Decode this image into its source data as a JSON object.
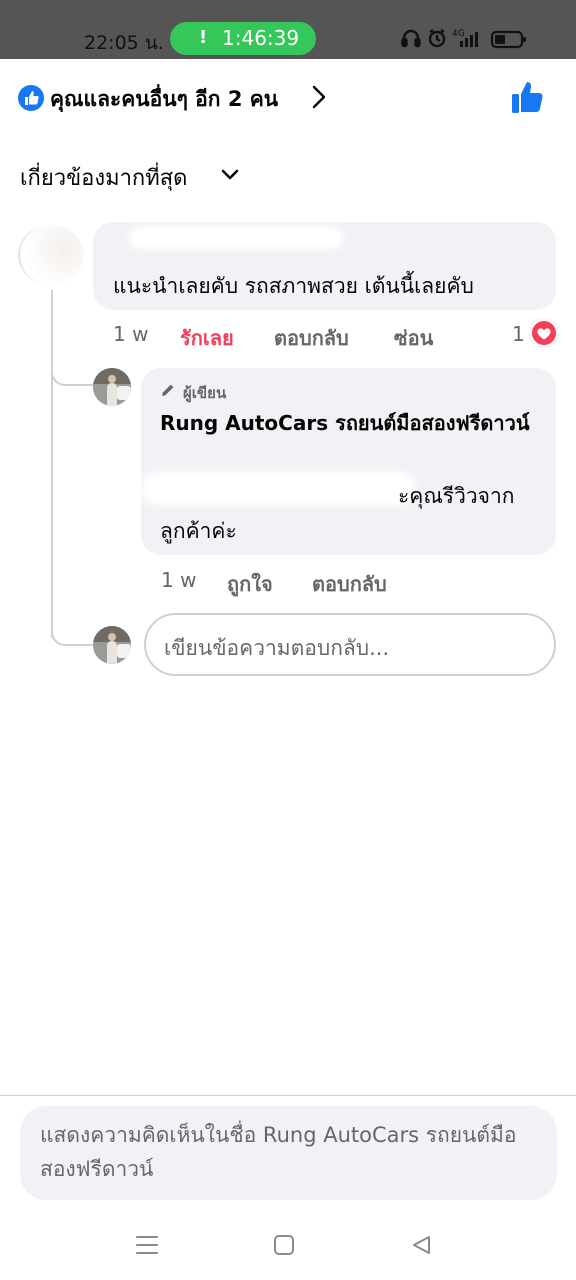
{
  "status_bar": {
    "time": "22:05 น.",
    "timer": "1:46:39",
    "timer_icon": "exclamation-icon",
    "network": "4G",
    "icons": [
      "headphones-icon",
      "alarm-icon",
      "signal-icon",
      "battery-icon"
    ]
  },
  "reactions_header": {
    "text": "คุณและคนอื่นๆ อีก 2 คน",
    "icons": [
      "like-badge-icon",
      "chevron-right-icon",
      "thumbs-up-icon"
    ]
  },
  "sort": {
    "label": "เกี่ยวข้องมากที่สุด",
    "icon": "chevron-down-icon"
  },
  "comments": [
    {
      "text": "แนะนำเลยคับ รถสภาพสวย เต้นนี้เลยคับ",
      "time": "1 w",
      "react_label": "รักเลย",
      "reply_label": "ตอบกลับ",
      "hide_label": "ซ่อน",
      "reaction_count": "1",
      "reaction_icon": "heart-icon"
    }
  ],
  "reply": {
    "author_tag": "ผู้เขียน",
    "author_tag_icon": "pencil-icon",
    "author_name": "Rung  AutoCars รถยนต์มือสองฟรีดาวน์",
    "text_visible_tail": "ะคุณรีวิวจาก",
    "text_line2": "ลูกค้าค่ะ",
    "time": "1 w",
    "like_label": "ถูกใจ",
    "reply_label": "ตอบกลับ"
  },
  "reply_input": {
    "placeholder": "เขียนข้อความตอบกลับ..."
  },
  "bottom_input": {
    "placeholder": "แสดงความคิดเห็นในชื่อ Rung  AutoCars รถยนต์มือสองฟรีดาวน์"
  },
  "nav_bar": {
    "icons": [
      "menu-icon",
      "home-square-icon",
      "back-triangle-icon"
    ]
  },
  "colors": {
    "accent": "#1877f2",
    "love": "#f33e58",
    "timer_pill": "#35c759",
    "status_bar": "#555555",
    "bubble": "#f0f2f5",
    "secondary_text": "#65676b"
  }
}
